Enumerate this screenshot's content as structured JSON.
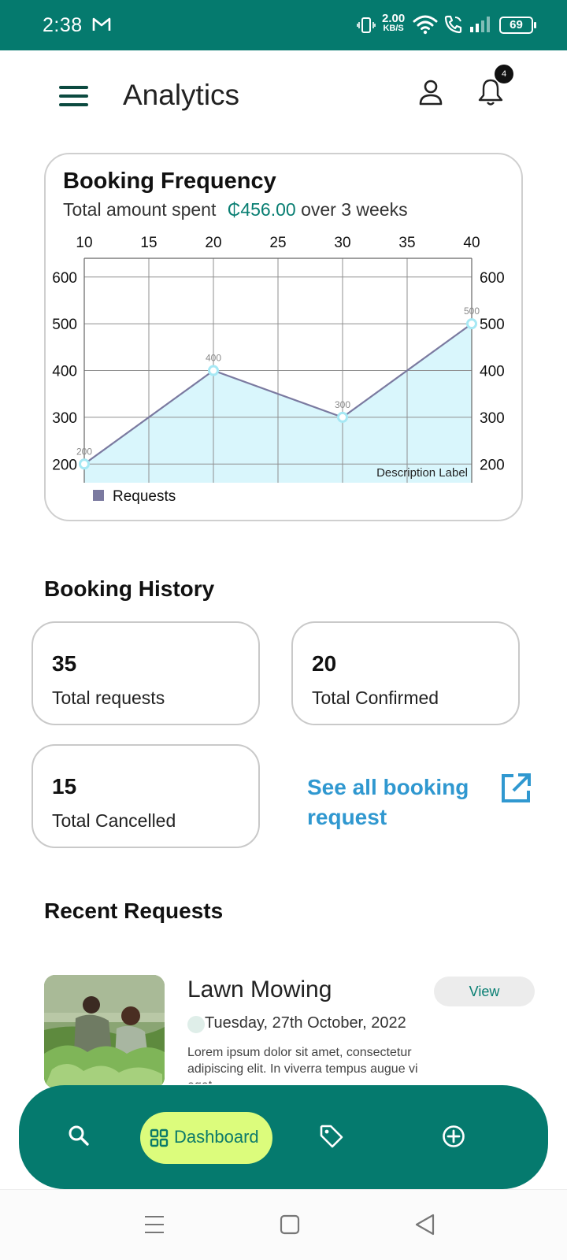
{
  "status_bar": {
    "time": "2:38",
    "net_speed": "2.00",
    "net_unit": "KB/S",
    "battery": "69",
    "icons": [
      "gmail-icon",
      "vibrate-icon",
      "wifi-icon",
      "wifi-calling-icon",
      "signal-icon",
      "battery-icon"
    ]
  },
  "header": {
    "title": "Analytics",
    "notification_count": "4",
    "icons": [
      "hamburger-menu-icon",
      "user-icon",
      "bell-icon"
    ]
  },
  "booking_frequency": {
    "title": "Booking Frequency",
    "subtitle_prefix": "Total amount spent",
    "amount": "₵456.00",
    "subtitle_suffix": "over 3 weeks"
  },
  "chart_data": {
    "type": "area",
    "x": [
      10,
      20,
      30,
      40
    ],
    "x_ticks": [
      "10",
      "15",
      "20",
      "25",
      "30",
      "35",
      "40"
    ],
    "y_ticks": [
      "200",
      "300",
      "400",
      "500",
      "600"
    ],
    "xlim": [
      10,
      40
    ],
    "ylim": [
      160,
      640
    ],
    "series": [
      {
        "name": "Requests",
        "values": [
          200,
          400,
          300,
          500
        ],
        "point_labels": [
          "200",
          "400",
          "300",
          "500"
        ]
      }
    ],
    "description": "Description Label",
    "grid": true,
    "legend": "bottom-left",
    "colors": {
      "line": "#7b7aa0",
      "fill": "#d9f6fc",
      "marker": "#a6e8f4",
      "legend": "#7b7aa0"
    }
  },
  "booking_history": {
    "title": "Booking History",
    "stats": [
      {
        "value": "35",
        "label": "Total requests"
      },
      {
        "value": "20",
        "label": "Total Confirmed"
      },
      {
        "value": "15",
        "label": "Total Cancelled"
      }
    ],
    "see_all": "See all booking request"
  },
  "recent_requests": {
    "title": "Recent Requests",
    "items": [
      {
        "title": "Lawn Mowing",
        "date": "Tuesday, 27th October, 2022",
        "description": "Lorem ipsum dolor sit amet, consectetur adipiscing elit. In viverra tempus augue vi eget",
        "action": "View"
      }
    ]
  },
  "bottom_nav": {
    "active_label": "Dashboard",
    "items": [
      "search-icon",
      "dashboard-icon",
      "tag-icon",
      "add-circle-icon"
    ]
  },
  "colors": {
    "primary": "#057a6e",
    "accent": "#dcfc7c",
    "link": "#3098d0"
  }
}
